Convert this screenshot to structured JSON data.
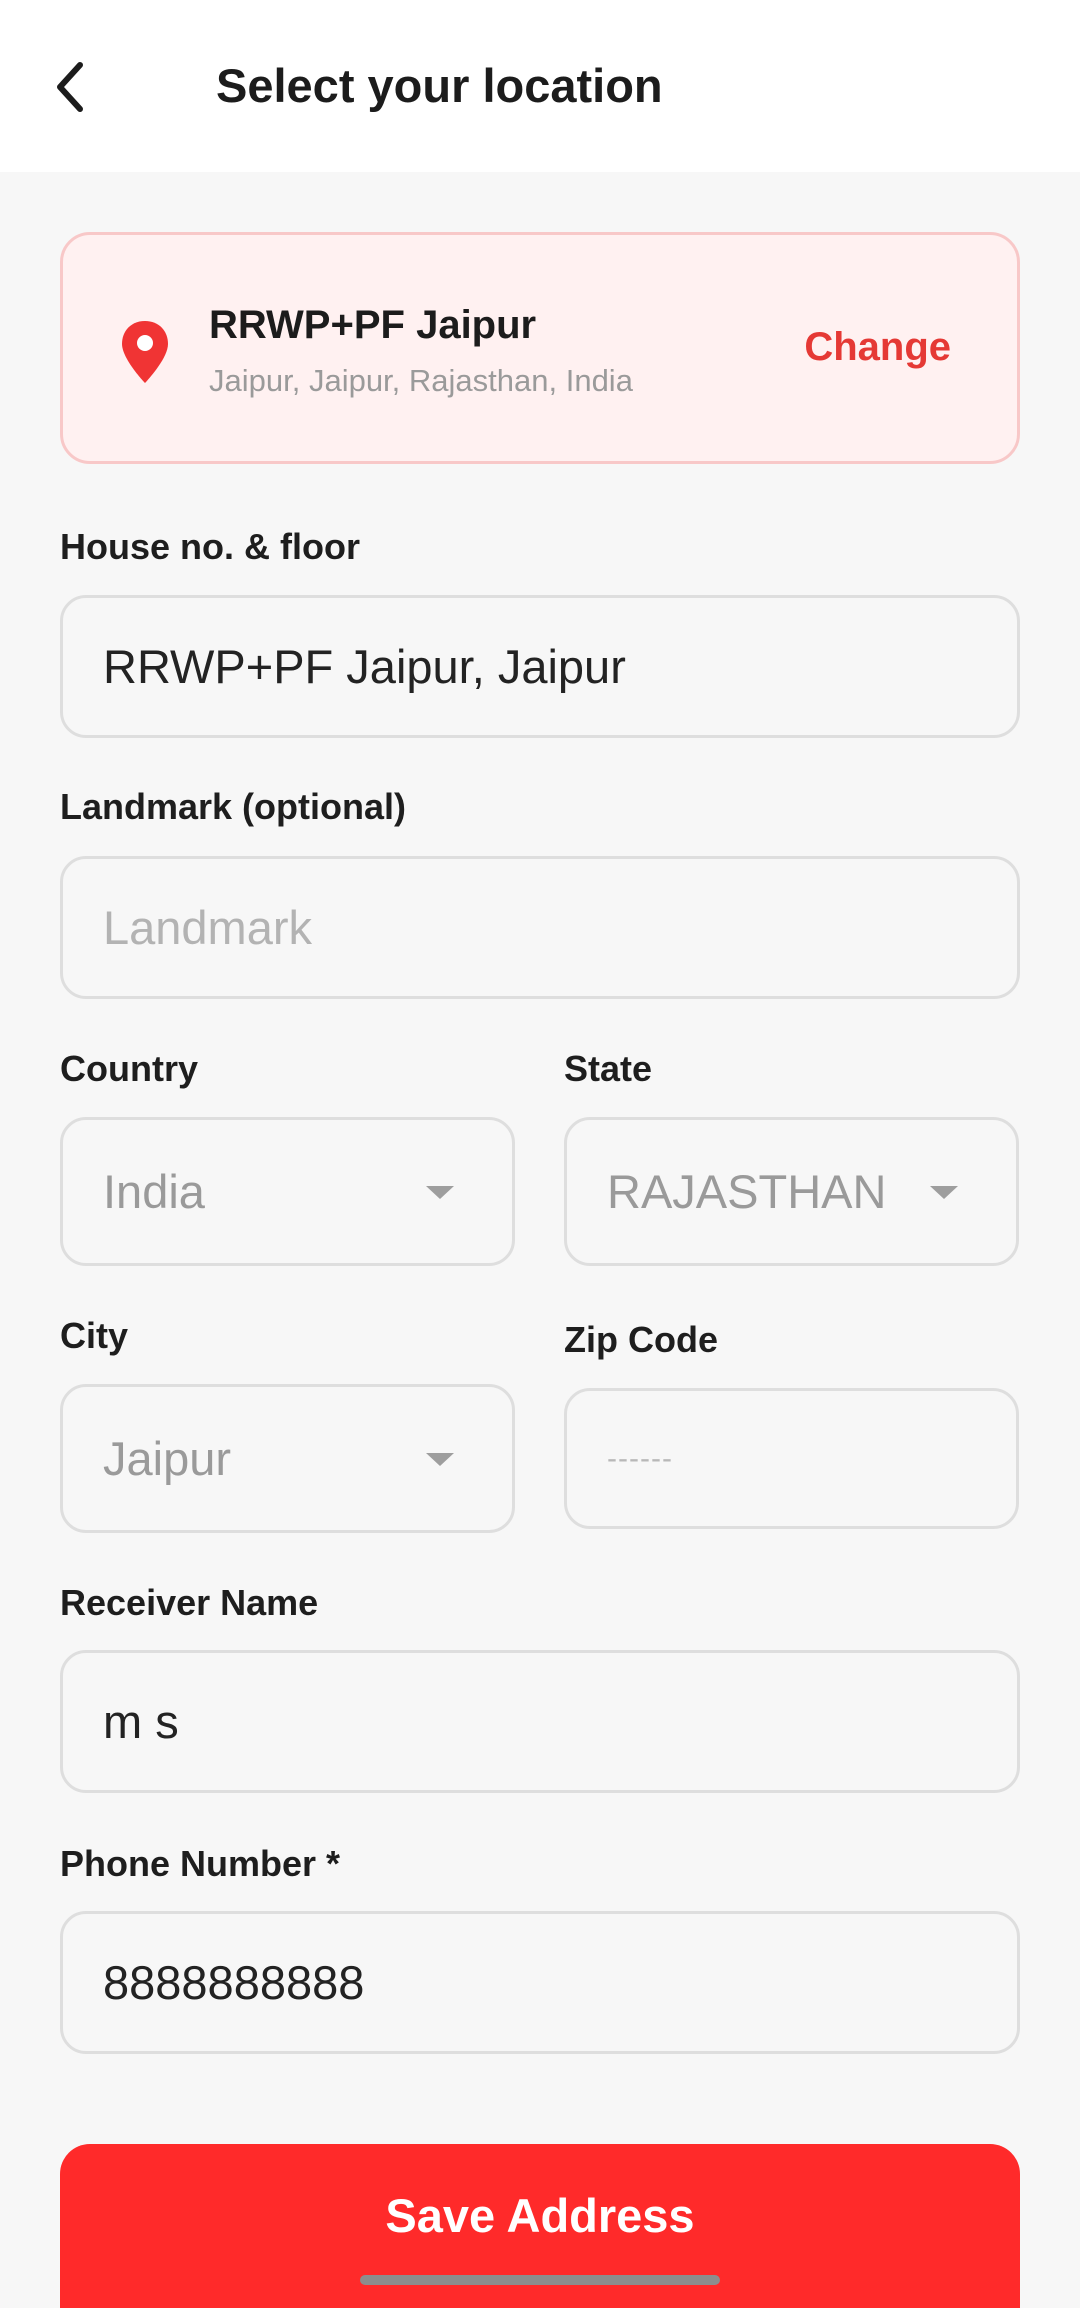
{
  "header": {
    "title": "Select your location"
  },
  "location": {
    "title": "RRWP+PF Jaipur",
    "subtitle": "Jaipur, Jaipur, Rajasthan, India",
    "change_label": "Change"
  },
  "form": {
    "house": {
      "label": "House no. & floor",
      "value": "RRWP+PF Jaipur, Jaipur"
    },
    "landmark": {
      "label": "Landmark (optional)",
      "placeholder": "Landmark"
    },
    "country": {
      "label": "Country",
      "value": "India"
    },
    "state": {
      "label": "State",
      "value": "RAJASTHAN"
    },
    "city": {
      "label": "City",
      "value": "Jaipur"
    },
    "zip": {
      "label": "Zip Code",
      "placeholder": "------"
    },
    "receiver": {
      "label": "Receiver Name",
      "value": "m s"
    },
    "phone": {
      "label": "Phone Number *",
      "value": "8888888888"
    }
  },
  "actions": {
    "save_label": "Save Address"
  },
  "colors": {
    "accent": "#ff2a2a",
    "change_text": "#e53935",
    "card_bg": "#fff1f1",
    "card_border": "#f8c8c8"
  },
  "icons": {
    "back": "chevron-left-icon",
    "pin": "location-pin-icon",
    "dropdown": "caret-down-icon"
  }
}
